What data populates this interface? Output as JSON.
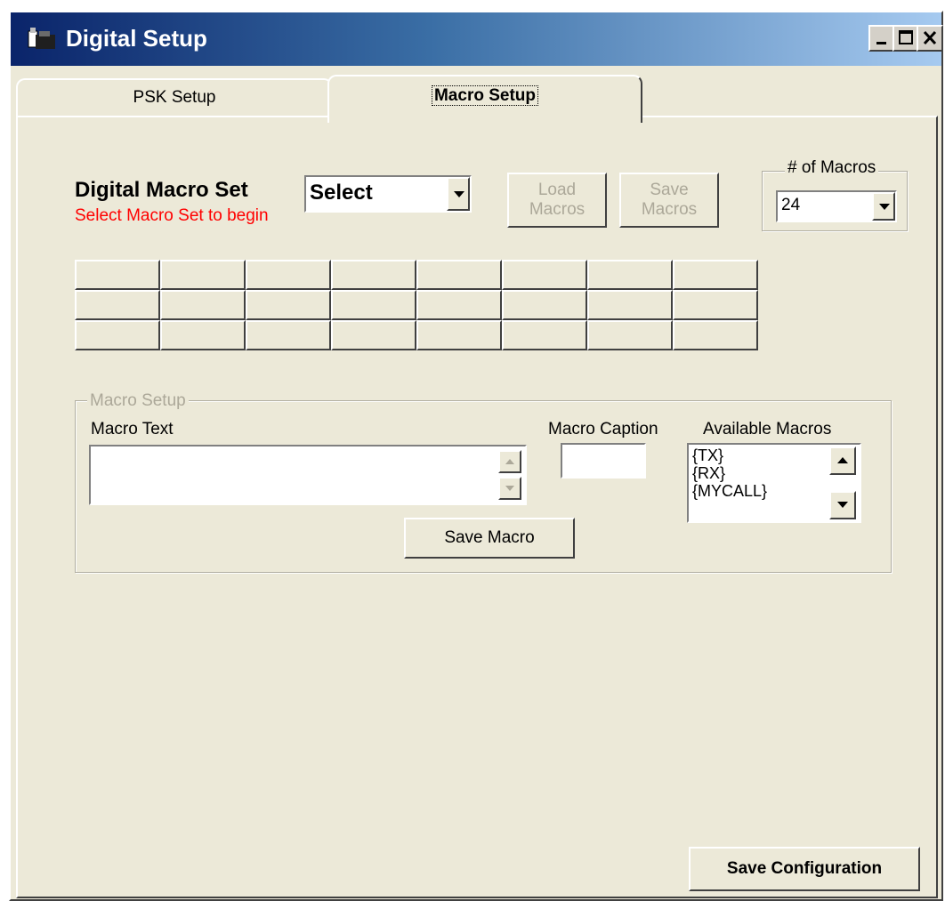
{
  "window": {
    "title": "Digital Setup",
    "controls": [
      "minimize",
      "maximize",
      "close"
    ]
  },
  "tabs": [
    {
      "label": "PSK Setup",
      "active": false
    },
    {
      "label": "Macro Setup",
      "active": true
    }
  ],
  "macro_set": {
    "label": "Digital Macro Set",
    "hint": "Select Macro Set to begin",
    "selected": "Select",
    "load_button": "Load\nMacros",
    "save_button": "Save\nMacros"
  },
  "num_macros": {
    "label": "# of Macros",
    "selected": "24"
  },
  "macro_grid": {
    "rows": 3,
    "cols": 8
  },
  "macro_setup": {
    "group_label": "Macro Setup",
    "text_label": "Macro Text",
    "text_value": "",
    "caption_label": "Macro Caption",
    "caption_value": "",
    "available_label": "Available Macros",
    "available_items": [
      "{TX}",
      "{RX}",
      "{MYCALL}"
    ],
    "save_button": "Save Macro"
  },
  "save_configuration": "Save Configuration",
  "colors": {
    "face": "#ece9d8",
    "hint_red": "#ff0000",
    "title_gradient_start": "#0a246a",
    "title_gradient_end": "#a6caf0"
  }
}
